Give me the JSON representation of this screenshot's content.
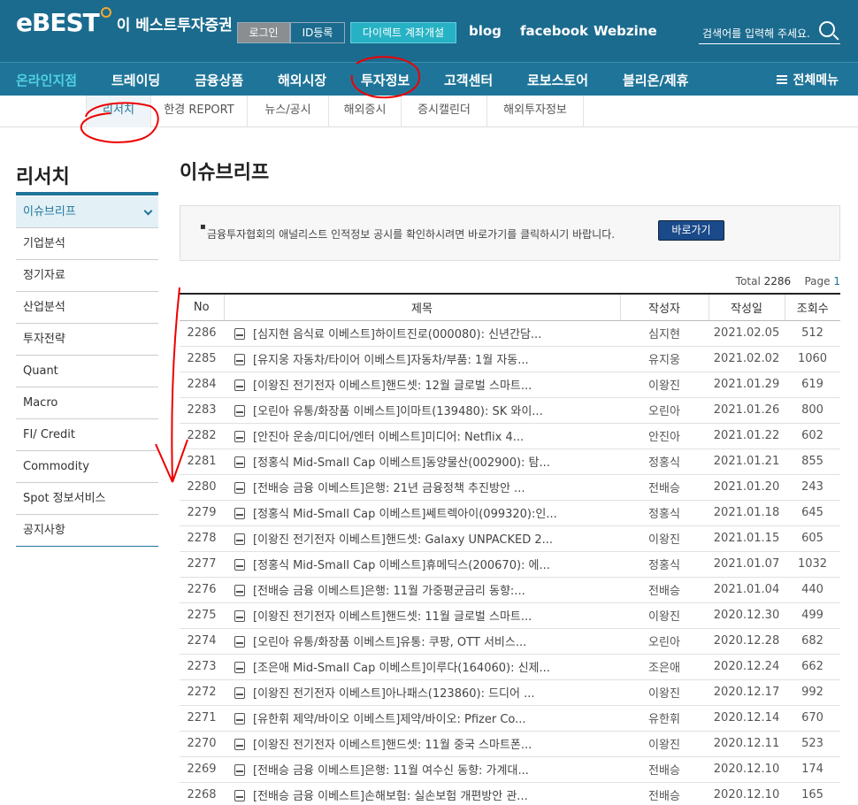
{
  "header": {
    "logo": "eBEST",
    "logo_text": "이 베스트투자증권",
    "login": "로그인",
    "id_register": "ID등록",
    "direct_account": "다이렉트 계좌개설",
    "links": [
      "blog",
      "facebook",
      "Webzine"
    ],
    "search_placeholder": "검색어를 입력해 주세요."
  },
  "nav": {
    "items": [
      "온라인지점",
      "트레이딩",
      "금융상품",
      "해외시장",
      "투자정보",
      "고객센터",
      "로보스토어",
      "블리온/제휴"
    ],
    "all_menu": "전체메뉴"
  },
  "subnav": {
    "items": [
      "리서치",
      "한경 REPORT",
      "뉴스/공시",
      "해외증시",
      "증시캘린더",
      "해외투자정보"
    ]
  },
  "sidebar": {
    "title": "리서치",
    "items": [
      "이슈브리프",
      "기업분석",
      "정기자료",
      "산업분석",
      "투자전략",
      "Quant",
      "Macro",
      "FI/ Credit",
      "Commodity",
      "Spot 정보서비스",
      "공지사항"
    ]
  },
  "content": {
    "title": "이슈브리프",
    "notice": "금융투자협회의 애널리스트 인적정보 공시를 확인하시려면 바로가기를 클릭하시기 바랍니다.",
    "notice_button": "바로가기",
    "total_label": "Total",
    "total_count": "2286",
    "page_label": "Page",
    "page_num": "1"
  },
  "table": {
    "headers": [
      "No",
      "제목",
      "작성자",
      "작성일",
      "조회수"
    ],
    "rows": [
      [
        "2286",
        "[심지현 음식료 이베스트]하이트진로(000080): 신년간담...",
        "심지현",
        "2021.02.05",
        "512"
      ],
      [
        "2285",
        "[유지웅 자동차/타이어 이베스트]자동차/부품: 1월 자동...",
        "유지웅",
        "2021.02.02",
        "1060"
      ],
      [
        "2284",
        "[이왕진 전기전자 이베스트]핸드셋: 12월 글로벌 스마트...",
        "이왕진",
        "2021.01.29",
        "619"
      ],
      [
        "2283",
        "[오린아 유통/화장품 이베스트]이마트(139480): SK 와이...",
        "오린아",
        "2021.01.26",
        "800"
      ],
      [
        "2282",
        "[안진아 운송/미디어/엔터 이베스트]미디어: Netflix 4...",
        "안진아",
        "2021.01.22",
        "602"
      ],
      [
        "2281",
        "[정홍식 Mid-Small Cap 이베스트]동양물산(002900): 탐...",
        "정홍식",
        "2021.01.21",
        "855"
      ],
      [
        "2280",
        "[전배승 금융 이베스트]은행: 21년 금융정책 추진방안 ...",
        "전배승",
        "2021.01.20",
        "243"
      ],
      [
        "2279",
        "[정홍식 Mid-Small Cap 이베스트]쎄트렉아이(099320):인...",
        "정홍식",
        "2021.01.18",
        "645"
      ],
      [
        "2278",
        "[이왕진 전기전자 이베스트]핸드셋: Galaxy UNPACKED 2...",
        "이왕진",
        "2021.01.15",
        "605"
      ],
      [
        "2277",
        "[정홍식 Mid-Small Cap 이베스트]휴메딕스(200670): 에...",
        "정홍식",
        "2021.01.07",
        "1032"
      ],
      [
        "2276",
        "[전배승 금융 이베스트]은행: 11월 가중평균금리 동향:...",
        "전배승",
        "2021.01.04",
        "440"
      ],
      [
        "2275",
        "[이왕진 전기전자 이베스트]핸드셋: 11월 글로벌 스마트...",
        "이왕진",
        "2020.12.30",
        "499"
      ],
      [
        "2274",
        "[오린아 유통/화장품 이베스트]유통: 쿠팡, OTT 서비스...",
        "오린아",
        "2020.12.28",
        "682"
      ],
      [
        "2273",
        "[조은애 Mid-Small Cap 이베스트]이루다(164060): 신제...",
        "조은애",
        "2020.12.24",
        "662"
      ],
      [
        "2272",
        "[이왕진 전기전자 이베스트]아나패스(123860): 드디어 ...",
        "이왕진",
        "2020.12.17",
        "992"
      ],
      [
        "2271",
        "[유한휘 제약/바이오 이베스트]제약/바이오: Pfizer Co...",
        "유한휘",
        "2020.12.14",
        "670"
      ],
      [
        "2270",
        "[이왕진 전기전자 이베스트]핸드셋: 11월 중국 스마트폰...",
        "이왕진",
        "2020.12.11",
        "523"
      ],
      [
        "2269",
        "[전배승 금융 이베스트]은행: 11월 여수신 동향: 가계대...",
        "전배승",
        "2020.12.10",
        "174"
      ],
      [
        "2268",
        "[전배승 금융 이베스트]손해보험: 실손보험 개편방안 관...",
        "전배승",
        "2020.12.10",
        "165"
      ]
    ]
  }
}
